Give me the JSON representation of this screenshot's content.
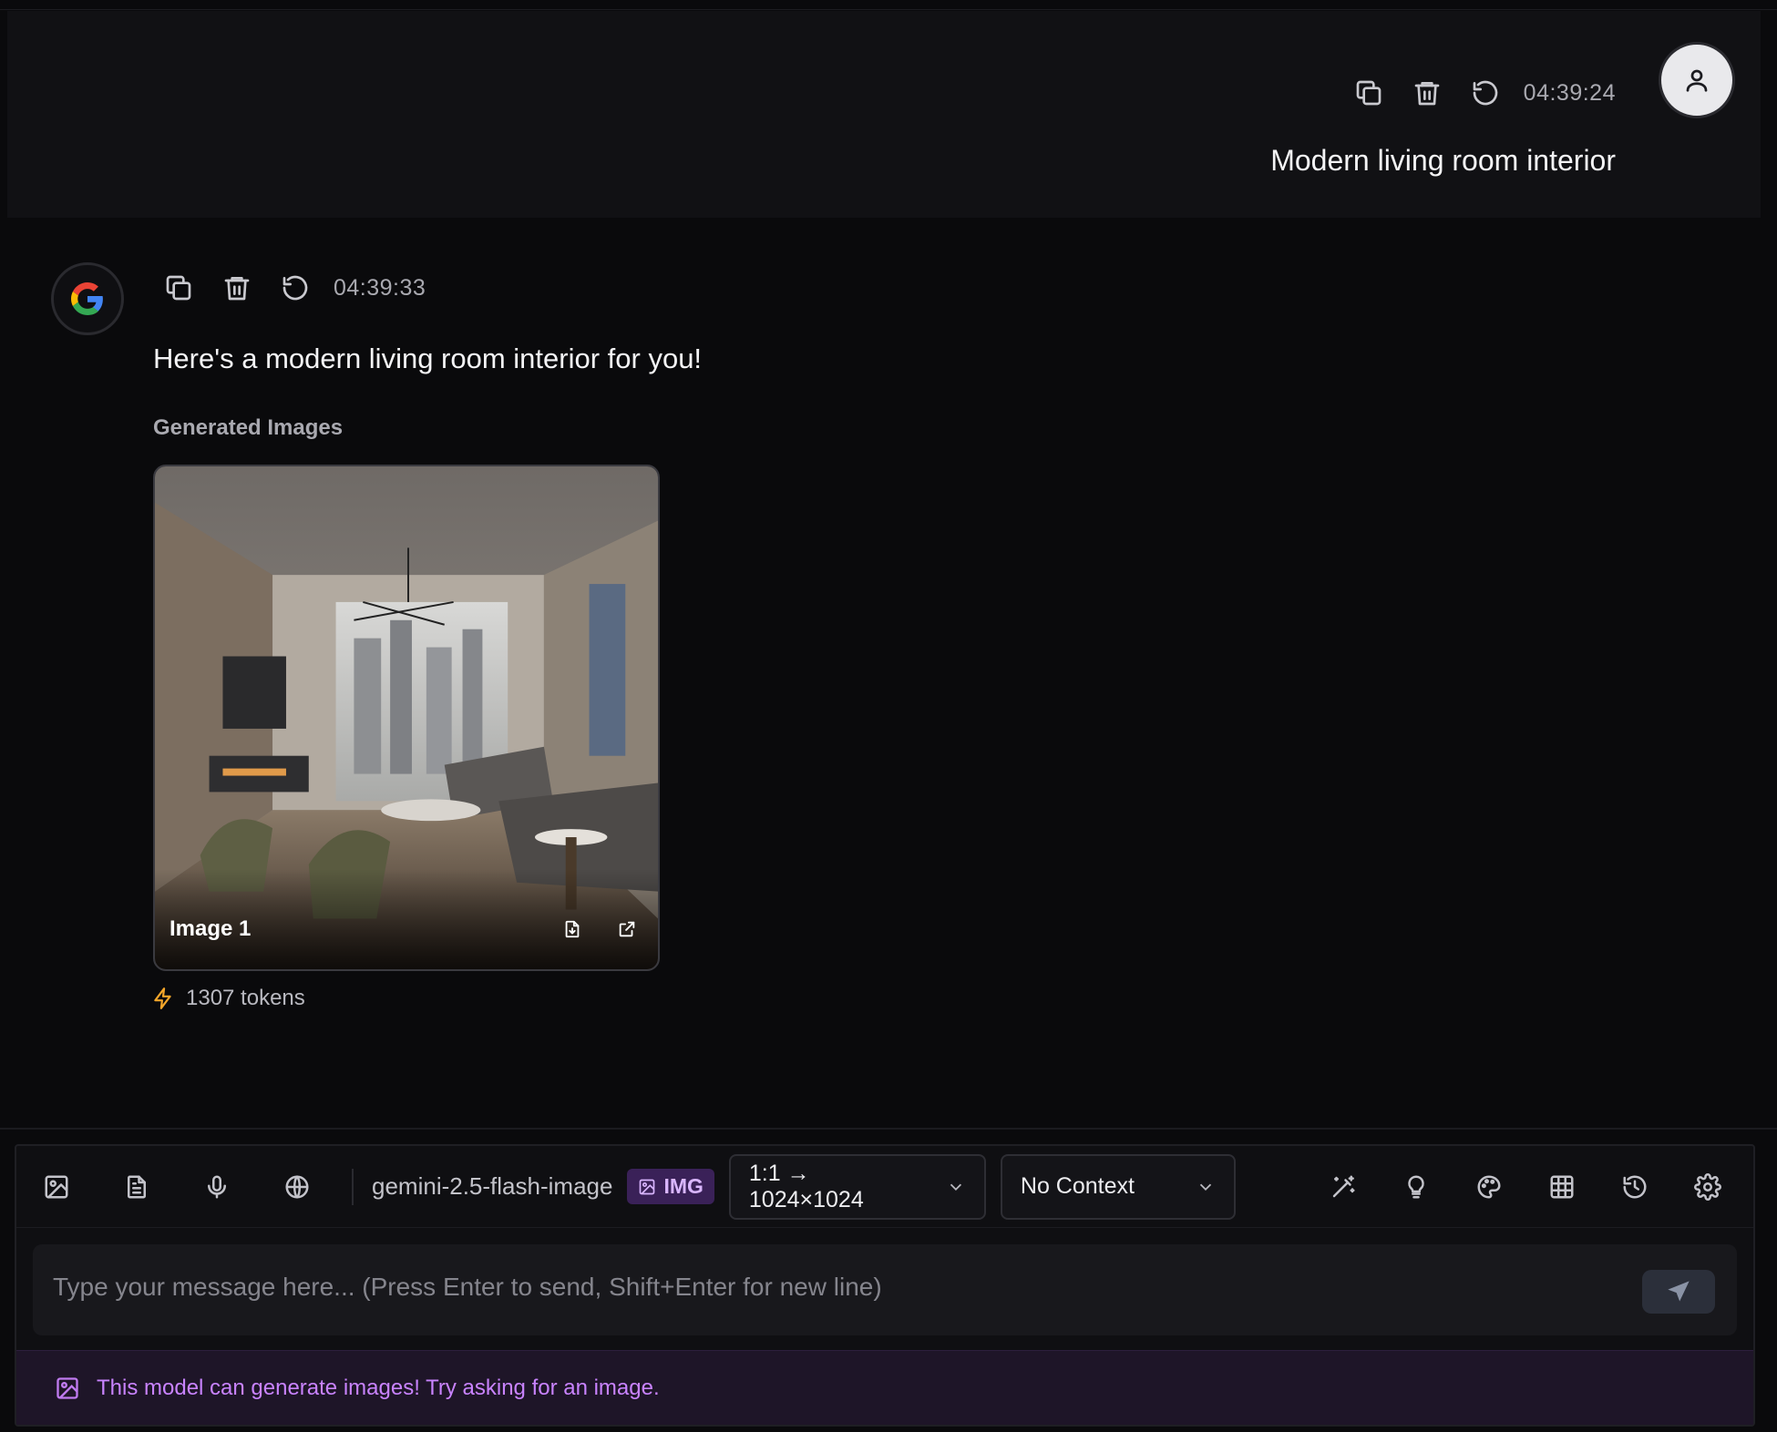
{
  "user_message": {
    "timestamp": "04:39:24",
    "text": "Modern living room interior"
  },
  "assistant_message": {
    "timestamp": "04:39:33",
    "avatar_icon": "google-g-logo",
    "text": "Here's a modern living room interior for you!",
    "generated_label": "Generated Images",
    "images": [
      {
        "label": "Image 1"
      }
    ],
    "tokens": "1307 tokens"
  },
  "composer": {
    "model_name": "gemini-2.5-flash-image",
    "model_badge": "IMG",
    "aspect_select": "1:1 → 1024×1024",
    "context_select": "No Context",
    "input_placeholder": "Type your message here... (Press Enter to send, Shift+Enter for new line)",
    "hint": "This model can generate images! Try asking for an image."
  },
  "colors": {
    "background": "#0a0a0c",
    "user_bubble": "#111114",
    "accent_purple": "#c983ff",
    "token_bolt": "#f4a62a"
  }
}
